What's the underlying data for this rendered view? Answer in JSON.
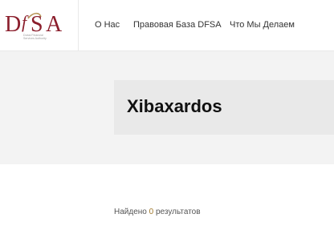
{
  "logo": {
    "mark": "DFSA",
    "subtitle_lines": [
      "Dubai Financial",
      "Services Authority"
    ],
    "colors": {
      "mark": "#8b1e2c",
      "accent": "#b8975a",
      "subtitle": "#9c9c9c"
    }
  },
  "nav": {
    "items": [
      {
        "label": "О Нас"
      },
      {
        "label": "Правовая База DFSA"
      },
      {
        "label": "Что Мы Делаем"
      }
    ]
  },
  "hero": {
    "title": "Xibaxardos"
  },
  "results": {
    "prefix": "Найдено",
    "count": "0",
    "suffix": "результатов"
  },
  "colors": {
    "hero_bg": "#f3f3f3",
    "title_card_bg": "#e9e9e9",
    "count_accent": "#a0782b"
  }
}
